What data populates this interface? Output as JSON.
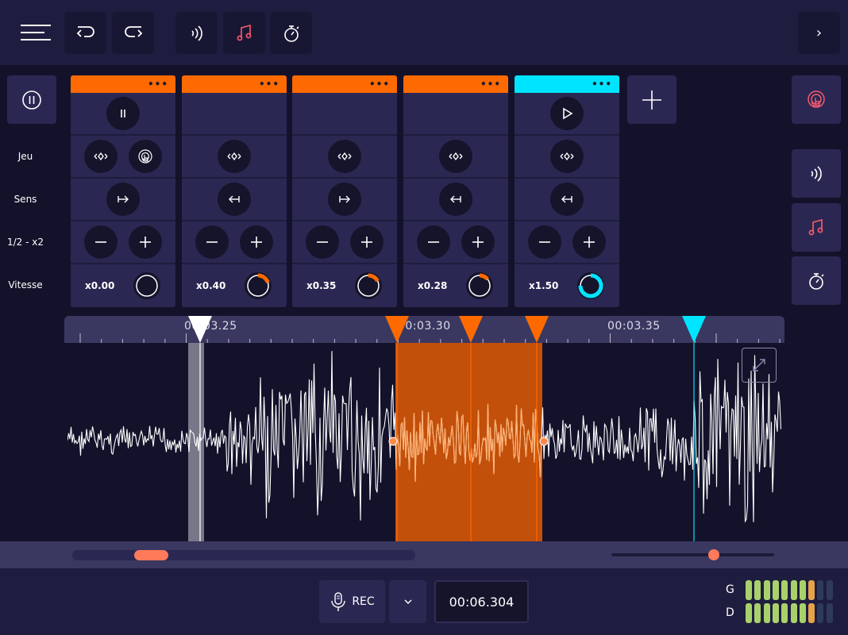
{
  "colors": {
    "orange": "#ff6a00",
    "cyan": "#00e5ff",
    "background": "#13122a",
    "panel": "#2a2852",
    "toolbar": "#1f1d3f",
    "pink": "#ff5a6e",
    "vu_green": "#a9d16b",
    "vu_orange": "#e8a24a",
    "vu_off": "#2e3a5a"
  },
  "toolbar": {
    "menu_icon": "hamburger-icon",
    "undo_icon": "undo-icon",
    "redo_icon": "redo-icon",
    "sound_icon": "sound-waves-icon",
    "music_icon": "music-note-icon",
    "timer_icon": "stopwatch-icon",
    "next_label": "›"
  },
  "row_labels": [
    "Jeu",
    "Sens",
    "1/2 - x2",
    "Vitesse"
  ],
  "tracks": [
    {
      "color": "orange",
      "state": "pause",
      "direction": "forward",
      "speed": "x0.00",
      "knob_level": 0.0,
      "has_touch": true
    },
    {
      "color": "orange",
      "state": "none",
      "direction": "backward",
      "speed": "x0.40",
      "knob_level": 0.2,
      "has_touch": false
    },
    {
      "color": "orange",
      "state": "none",
      "direction": "forward",
      "speed": "x0.35",
      "knob_level": 0.175,
      "has_touch": false
    },
    {
      "color": "orange",
      "state": "none",
      "direction": "backward",
      "speed": "x0.28",
      "knob_level": 0.14,
      "has_touch": false
    },
    {
      "color": "cyan",
      "state": "play",
      "direction": "backward",
      "speed": "x1.50",
      "knob_level": 0.75,
      "has_touch": false
    }
  ],
  "track_ui": {
    "menu_dots": "•••",
    "minus": "−",
    "plus": "+"
  },
  "timeline": {
    "labels": [
      "00:03.25",
      "00:03.30",
      "00:03.35"
    ]
  },
  "scroll": {
    "position": 0.2,
    "zoom": 0.63
  },
  "bottom": {
    "rec_label": "REC",
    "time": "00:06.304",
    "vu_left_label": "G",
    "vu_right_label": "D",
    "vu_left_level": 8,
    "vu_right_level": 8,
    "vu_total": 10
  }
}
